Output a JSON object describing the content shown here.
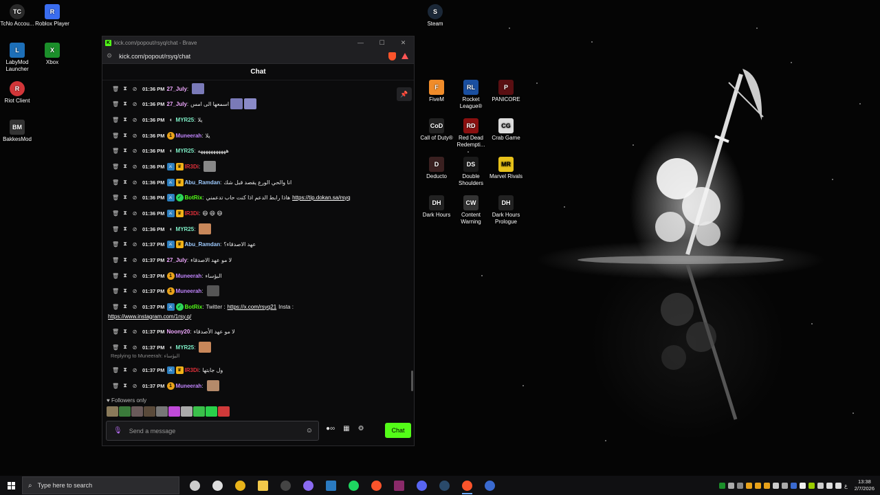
{
  "desktop": {
    "icons_left": [
      {
        "label": "TcNo Accou...",
        "glyph": "TC",
        "color": "#2a2a2a"
      },
      {
        "label": "Roblox Player",
        "glyph": "R",
        "color": "#3a6df0"
      },
      {
        "label": "LabyMod Launcher",
        "glyph": "L",
        "color": "#1d6fb8"
      },
      {
        "label": "Xbox",
        "glyph": "X",
        "color": "#1b8f2a"
      },
      {
        "label": "Riot Client",
        "glyph": "R",
        "color": "#d13639"
      },
      {
        "label": "BakkesMod",
        "glyph": "BM",
        "color": "#333"
      }
    ],
    "icon_steam": {
      "label": "Steam",
      "glyph": "S",
      "color": "#1b2838"
    },
    "icons_grid": [
      {
        "label": "FiveM",
        "glyph": "F",
        "color": "#f08c2a"
      },
      {
        "label": "Rocket League®",
        "glyph": "RL",
        "color": "#1a4fa0"
      },
      {
        "label": "PANICORE",
        "glyph": "P",
        "color": "#5a0f12"
      },
      {
        "label": "Call of Duty®",
        "glyph": "CoD",
        "color": "#222"
      },
      {
        "label": "Red Dead Redempti...",
        "glyph": "RD",
        "color": "#8a1010"
      },
      {
        "label": "Crab Game",
        "glyph": "CG",
        "color": "#ddd"
      },
      {
        "label": "Deducto",
        "glyph": "D",
        "color": "#3a2020"
      },
      {
        "label": "Double Shoulders",
        "glyph": "DS",
        "color": "#1a1a1a"
      },
      {
        "label": "Marvel Rivals",
        "glyph": "MR",
        "color": "#e8c21a"
      },
      {
        "label": "Dark Hours",
        "glyph": "DH",
        "color": "#222"
      },
      {
        "label": "Content Warning",
        "glyph": "CW",
        "color": "#333"
      },
      {
        "label": "Dark Hours Prologue",
        "glyph": "DH",
        "color": "#222"
      }
    ]
  },
  "browser": {
    "title": "kick.com/popout/rsyq/chat - Brave",
    "address": "kick.com/popout/rsyq/chat",
    "controls": {
      "minimize": "—",
      "maximize": "☐",
      "close": "✕"
    }
  },
  "chat": {
    "header": "Chat",
    "messages": [
      {
        "time": "01:36 PM",
        "badges": [],
        "user": "27_July",
        "color": "#f0a8ff",
        "text": "",
        "emotes": [
          "#7a7ab8"
        ]
      },
      {
        "time": "01:36 PM",
        "badges": [],
        "user": "27_July",
        "color": "#f0a8ff",
        "text": "اسمعها الى امس",
        "emotes": [
          "#7a7ab8",
          "#8a8ac8"
        ]
      },
      {
        "time": "01:36 PM",
        "badges": [
          "moon"
        ],
        "user": "MYR25",
        "color": "#7ff0c8",
        "text": "يلا",
        "emotes": []
      },
      {
        "time": "01:36 PM",
        "badges": [
          "sub"
        ],
        "user": "Muneerah",
        "color": "#c084fc",
        "text": "يلا",
        "emotes": []
      },
      {
        "time": "01:36 PM",
        "badges": [
          "moon"
        ],
        "user": "MYR25",
        "color": "#7ff0c8",
        "text": "هههههههههههه",
        "emotes": []
      },
      {
        "time": "01:36 PM",
        "badges": [
          "mod",
          "crown"
        ],
        "user": "IR3Di",
        "color": "#e3303a",
        "text": "",
        "emotes": [
          "#888"
        ]
      },
      {
        "time": "01:36 PM",
        "badges": [
          "mod",
          "crown"
        ],
        "user": "Abu_Ramdan",
        "color": "#9ecbff",
        "text": "انا والحي الورع يقصد قبل شك",
        "emotes": []
      },
      {
        "time": "01:36 PM",
        "badges": [
          "mod",
          "bot"
        ],
        "user": "BotRix",
        "color": "#53fc18",
        "text": "هاذا رابط الدعم اذا كنت حاب تدعمني",
        "link": "https://tip.dokan.sa/rsyq",
        "emotes": []
      },
      {
        "time": "01:36 PM",
        "badges": [
          "mod",
          "crown"
        ],
        "user": "IR3Di",
        "color": "#e3303a",
        "text": "😄 😄 😄",
        "emotes": []
      },
      {
        "time": "01:36 PM",
        "badges": [
          "moon"
        ],
        "user": "MYR25",
        "color": "#7ff0c8",
        "text": "",
        "emotes": [
          "#c8875a"
        ]
      },
      {
        "time": "01:37 PM",
        "badges": [
          "mod",
          "crown"
        ],
        "user": "Abu_Ramdan",
        "color": "#9ecbff",
        "text": "عهد الاصدقاء؟",
        "emotes": []
      },
      {
        "time": "01:37 PM",
        "badges": [],
        "user": "27_July",
        "color": "#f0a8ff",
        "text": "لا مو عهد الاصدقاء",
        "emotes": []
      },
      {
        "time": "01:37 PM",
        "badges": [
          "sub"
        ],
        "user": "Muneerah",
        "color": "#c084fc",
        "text": "البؤساء",
        "emotes": []
      },
      {
        "time": "01:37 PM",
        "badges": [
          "sub"
        ],
        "user": "Muneerah",
        "color": "#c084fc",
        "text": "",
        "emotes": [
          "#555"
        ]
      },
      {
        "time": "01:37 PM",
        "badges": [
          "mod",
          "bot"
        ],
        "user": "BotRix",
        "color": "#53fc18",
        "text": "Twitter :",
        "link": "https://x.com/rsyq21",
        "text2": "Insta :",
        "link2": "https://www.instagram.com/1rsy.q/",
        "emotes": []
      },
      {
        "time": "01:37 PM",
        "badges": [],
        "user": "Noony20",
        "color": "#f0a8ff",
        "text": "لا مو عهد الأصدقاء",
        "emotes": []
      },
      {
        "time": "01:37 PM",
        "badges": [
          "moon"
        ],
        "user": "MYR25",
        "color": "#7ff0c8",
        "text": "",
        "emotes": [
          "#c8875a"
        ]
      },
      {
        "time": "01:37 PM",
        "badges": [
          "mod",
          "crown"
        ],
        "user": "IR3Di",
        "color": "#e3303a",
        "text": "ول جابتها",
        "emotes": [],
        "reply": "Replying to Muneerah: البؤساء"
      },
      {
        "time": "01:37 PM",
        "badges": [
          "sub"
        ],
        "user": "Muneerah",
        "color": "#c084fc",
        "text": "",
        "emotes": [
          "#b58a6a"
        ]
      }
    ],
    "followers_only": "Followers only",
    "emote_bar": [
      "#8a7a5a",
      "#3a7a3a",
      "#6a5a5a",
      "#5a4a3a",
      "#777",
      "#c04ad8",
      "#aaa",
      "#3ac04a",
      "#2ad04a",
      "#d03a3a"
    ],
    "input_placeholder": "Send a message",
    "send_label": "Chat"
  },
  "taskbar": {
    "search_placeholder": "Type here to search",
    "apps": [
      {
        "name": "task-view",
        "color": "#ccc"
      },
      {
        "name": "settings-app",
        "color": "#ddd"
      },
      {
        "name": "chrome",
        "color": "#e8b31a"
      },
      {
        "name": "file-explorer",
        "color": "#f2c84a"
      },
      {
        "name": "obs",
        "color": "#444"
      },
      {
        "name": "discord-alt",
        "color": "#8a6af0"
      },
      {
        "name": "app-blue",
        "color": "#2a7ac0"
      },
      {
        "name": "spotify",
        "color": "#1ed760"
      },
      {
        "name": "brave",
        "color": "#fb542b"
      },
      {
        "name": "winrar",
        "color": "#8a2a6a"
      },
      {
        "name": "discord",
        "color": "#5865f2"
      },
      {
        "name": "steam",
        "color": "#2a4a6a"
      },
      {
        "name": "brave-active",
        "color": "#fb542b"
      },
      {
        "name": "app-network",
        "color": "#3a6ad0"
      }
    ],
    "lang": "ع",
    "time": "13:38",
    "date": "2/7/2026"
  }
}
